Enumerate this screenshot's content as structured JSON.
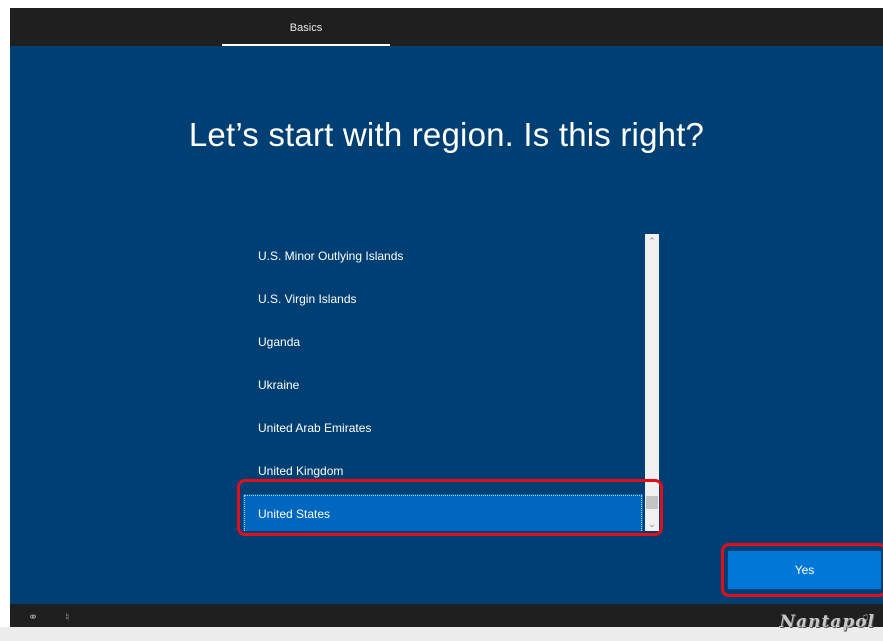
{
  "header": {
    "tab_label": "Basics"
  },
  "main": {
    "heading": "Let’s start with region. Is this right?",
    "regions": [
      "U.S. Minor Outlying Islands",
      "U.S. Virgin Islands",
      "Uganda",
      "Ukraine",
      "United Arab Emirates",
      "United Kingdom",
      "United States"
    ],
    "selected_region": "United States",
    "yes_label": "Yes"
  },
  "colors": {
    "background": "#003f73",
    "selected": "#0067c0",
    "button": "#0078d7",
    "annotation": "#e0101b"
  },
  "icons": [
    "ease-of-access-icon",
    "microphone-icon",
    "volume-icon",
    "scroll-up-icon",
    "scroll-down-icon"
  ],
  "watermark": "Nantapol"
}
